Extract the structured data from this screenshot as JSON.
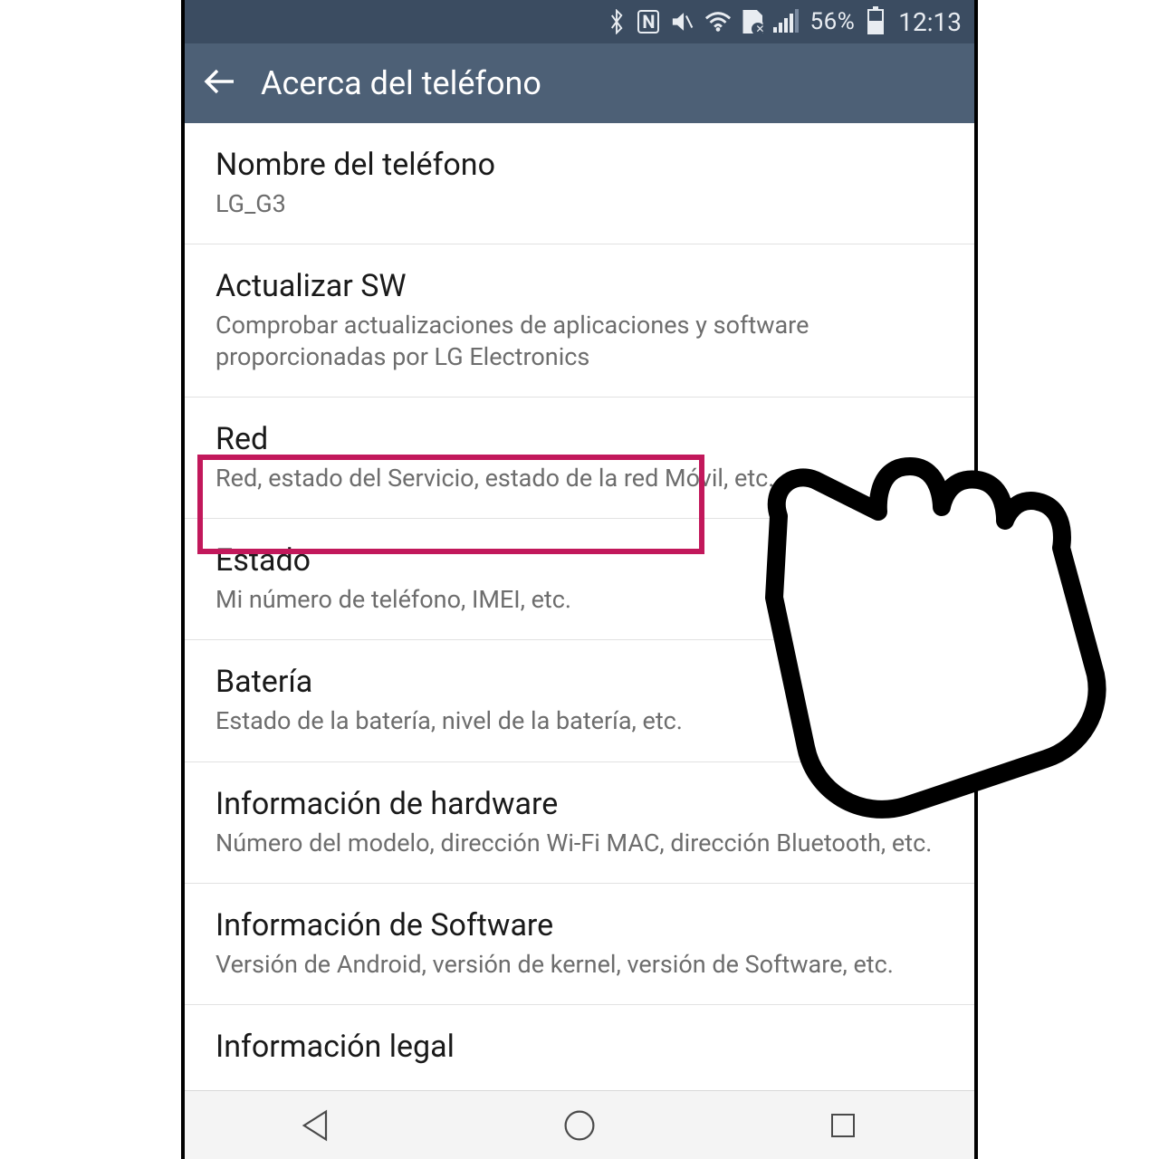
{
  "status": {
    "battery_percent": "56%",
    "time": "12:13"
  },
  "header": {
    "title": "Acerca del teléfono"
  },
  "items": [
    {
      "title": "Nombre del teléfono",
      "sub": "LG_G3"
    },
    {
      "title": "Actualizar SW",
      "sub": "Comprobar actualizaciones de aplicaciones y software proporcionadas por LG Electronics"
    },
    {
      "title": "Red",
      "sub": "Red, estado del Servicio, estado de la red Móvil, etc."
    },
    {
      "title": "Estado",
      "sub": "Mi número de teléfono, IMEI, etc."
    },
    {
      "title": "Batería",
      "sub": "Estado de la batería, nivel de la batería, etc."
    },
    {
      "title": "Información de hardware",
      "sub": "Número del modelo, dirección Wi-Fi MAC, dirección Bluetooth, etc."
    },
    {
      "title": "Información de Software",
      "sub": "Versión de Android, versión de kernel, versión de Software, etc."
    },
    {
      "title": "Información legal",
      "sub": ""
    }
  ],
  "highlight": {
    "index": 3
  },
  "colors": {
    "statusbar": "#3b4c61",
    "appbar": "#4d6076",
    "highlight": "#c2185b"
  }
}
